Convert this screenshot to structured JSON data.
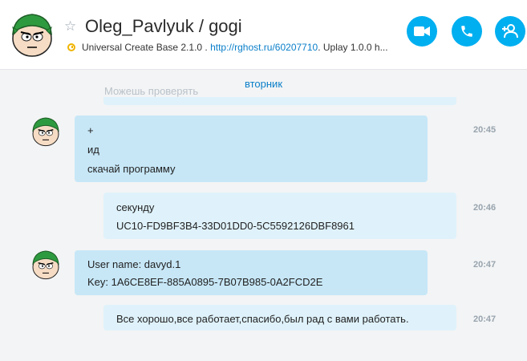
{
  "header": {
    "contact_name": "Oleg_Pavlyuk / gogi",
    "status_text": "Universal Create Base  2.1.0",
    "separator": " . ",
    "link_text": "http://rghost.ru/60207710",
    "trailing_text": ". Uplay 1.0.0 h..."
  },
  "buttons": {
    "video_call": "video-call",
    "voice_call": "voice-call",
    "add_people": "add-people"
  },
  "chat": {
    "day_label": "вторник",
    "faded_previous": "Можешь проверять",
    "messages": [
      {
        "lines": [
          "+",
          "ид",
          "скачай программу"
        ],
        "time": "20:45"
      },
      {
        "lines": [
          "секунду",
          "UC10-FD9BF3B4-33D01DD0-5C5592126DBF8961"
        ],
        "time": "20:46"
      },
      {
        "lines": [
          "User name: davyd.1",
          "Key: 1A6CE8EF-885A0895-7B07B985-0A2FCD2E"
        ],
        "time": "20:47"
      },
      {
        "lines": [
          "Все хорошо,все работает,спасибо,был рад с вами работать."
        ],
        "time": "20:47"
      }
    ]
  },
  "colors": {
    "accent": "#00aff0",
    "incoming_bubble": "#c7e7f7",
    "outgoing_bubble": "#dff2fb"
  }
}
